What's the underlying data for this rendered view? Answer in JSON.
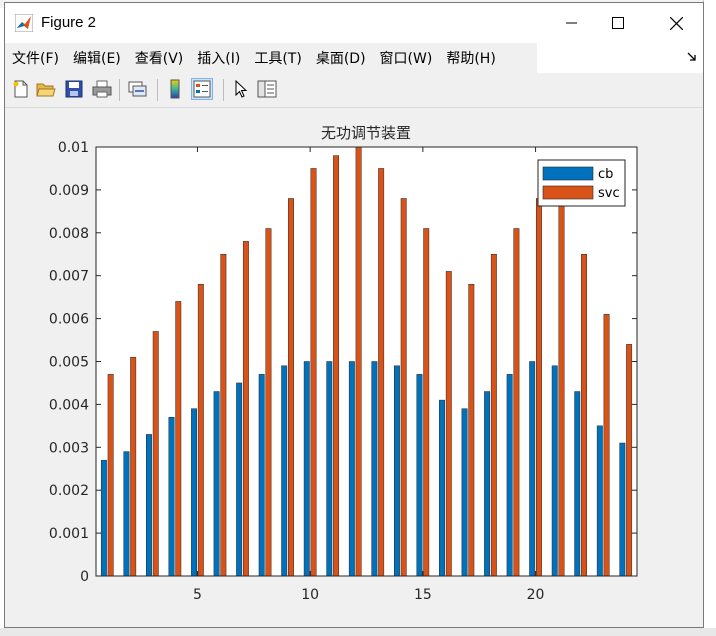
{
  "window": {
    "title": "Figure 2"
  },
  "menu": {
    "items": [
      "文件(F)",
      "编辑(E)",
      "查看(V)",
      "插入(I)",
      "工具(T)",
      "桌面(D)",
      "窗口(W)",
      "帮助(H)"
    ],
    "overflow_icon": "chevron-double-icon"
  },
  "toolbar": {
    "icons": [
      "new-figure-icon",
      "open-file-icon",
      "save-icon",
      "print-icon",
      "link-plot-icon",
      "colorbar-icon",
      "legend-icon",
      "pointer-icon",
      "property-inspector-icon"
    ]
  },
  "colors": {
    "cb": "#0072BD",
    "svc": "#D95319",
    "figure_bg": "#f0f0f0"
  },
  "chart_data": {
    "type": "bar",
    "title": "无功调节装置",
    "xlabel": "",
    "ylabel": "",
    "x": [
      1,
      2,
      3,
      4,
      5,
      6,
      7,
      8,
      9,
      10,
      11,
      12,
      13,
      14,
      15,
      16,
      17,
      18,
      19,
      20,
      21,
      22,
      23,
      24
    ],
    "series": [
      {
        "name": "cb",
        "values": [
          0.0027,
          0.0029,
          0.0033,
          0.0037,
          0.0039,
          0.0043,
          0.0045,
          0.0047,
          0.0049,
          0.005,
          0.005,
          0.005,
          0.005,
          0.0049,
          0.0047,
          0.0041,
          0.0039,
          0.0043,
          0.0047,
          0.005,
          0.0049,
          0.0043,
          0.0035,
          0.0031
        ]
      },
      {
        "name": "svc",
        "values": [
          0.0047,
          0.0051,
          0.0057,
          0.0064,
          0.0068,
          0.0075,
          0.0078,
          0.0081,
          0.0088,
          0.0095,
          0.0098,
          0.01,
          0.0095,
          0.0088,
          0.0081,
          0.0071,
          0.0068,
          0.0075,
          0.0081,
          0.0088,
          0.0088,
          0.0075,
          0.0061,
          0.0054
        ]
      }
    ],
    "xlim": [
      0.5,
      24.5
    ],
    "ylim": [
      0,
      0.01
    ],
    "xticks": [
      5,
      10,
      15,
      20
    ],
    "xtick_labels": [
      "5",
      "10",
      "15",
      "20"
    ],
    "yticks": [
      0,
      0.001,
      0.002,
      0.003,
      0.004,
      0.005,
      0.006,
      0.007,
      0.008,
      0.009,
      0.01
    ],
    "ytick_labels": [
      "0",
      "0.001",
      "0.002",
      "0.003",
      "0.004",
      "0.005",
      "0.006",
      "0.007",
      "0.008",
      "0.009",
      "0.01"
    ],
    "legend_position": "top-right",
    "grid": false
  }
}
